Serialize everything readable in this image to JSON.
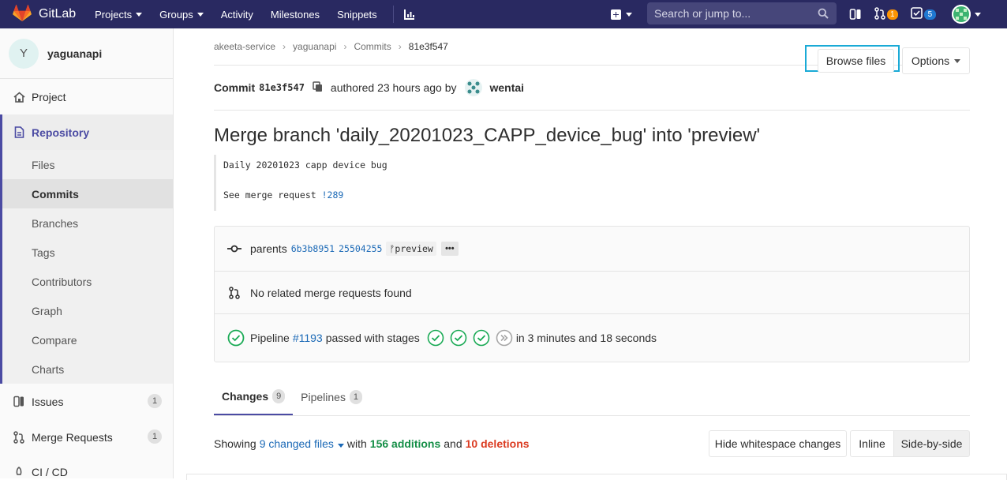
{
  "navbar": {
    "brand": "GitLab",
    "links": [
      {
        "label": "Projects",
        "dropdown": true
      },
      {
        "label": "Groups",
        "dropdown": true
      },
      {
        "label": "Activity",
        "dropdown": false
      },
      {
        "label": "Milestones",
        "dropdown": false
      },
      {
        "label": "Snippets",
        "dropdown": false
      }
    ],
    "search_placeholder": "Search or jump to...",
    "issues_badge": "1",
    "todos_badge": "5",
    "colors": {
      "background": "#292961",
      "accent": "#fc9403"
    }
  },
  "sidebar": {
    "project_initial": "Y",
    "project_name": "yaguanapi",
    "project_label": "Project",
    "repository_label": "Repository",
    "repo_items": [
      "Files",
      "Commits",
      "Branches",
      "Tags",
      "Contributors",
      "Graph",
      "Compare",
      "Charts"
    ],
    "active_item": "Commits",
    "issues_label": "Issues",
    "issues_count": "1",
    "mr_label": "Merge Requests",
    "mr_count": "1",
    "cicd_label": "CI / CD"
  },
  "breadcrumb": [
    "akeeta-service",
    "yaguanapi",
    "Commits",
    "81e3f547"
  ],
  "commit": {
    "label": "Commit",
    "sha": "81e3f547",
    "authored_text": "authored 23 hours ago by",
    "author": "wentai",
    "browse_files": "Browse files",
    "options": "Options",
    "title": "Merge branch 'daily_20201023_CAPP_device_bug' into 'preview'",
    "description_line1": "Daily 20201023 capp device bug",
    "description_line2_prefix": "See merge request ",
    "description_mr": "!289"
  },
  "info": {
    "parents_label": "parents",
    "parent1": "6b3b8951",
    "parent2": "25504255",
    "branch": "preview",
    "more": "•••",
    "no_mr": "No related merge requests found",
    "pipeline_label": "Pipeline",
    "pipeline_id": "#1193",
    "pipeline_status": "passed with stages",
    "duration": "in 3 minutes and 18 seconds"
  },
  "tabs": [
    {
      "label": "Changes",
      "count": "9"
    },
    {
      "label": "Pipelines",
      "count": "1"
    }
  ],
  "summary": {
    "showing": "Showing",
    "changed_files": "9 changed files",
    "with": "with",
    "additions": "156 additions",
    "and": "and",
    "deletions": "10 deletions",
    "hide_ws": "Hide whitespace changes",
    "inline": "Inline",
    "side_by_side": "Side-by-side"
  }
}
